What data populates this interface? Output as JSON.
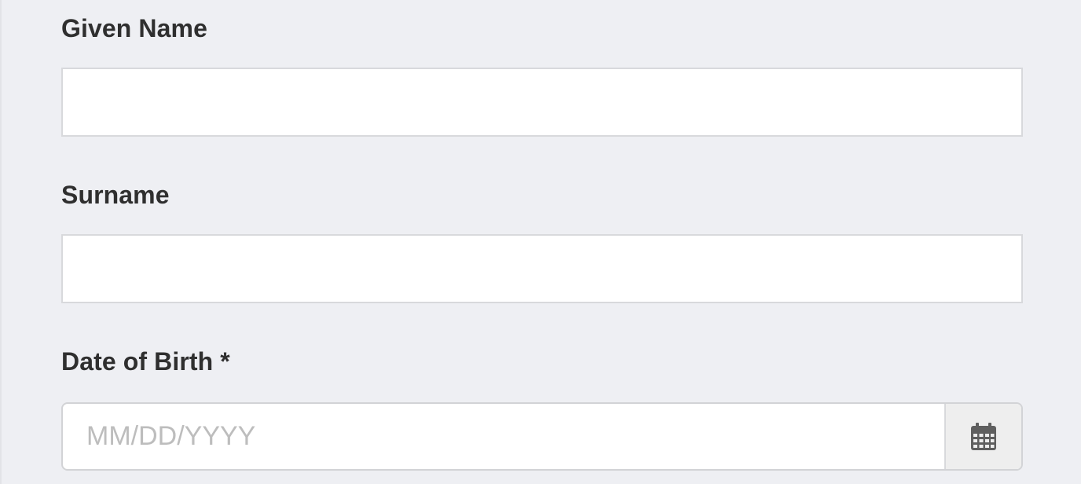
{
  "form": {
    "given_name": {
      "label": "Given Name",
      "value": "",
      "placeholder": ""
    },
    "surname": {
      "label": "Surname",
      "value": "",
      "placeholder": ""
    },
    "date_of_birth": {
      "label": "Date of Birth *",
      "value": "",
      "placeholder": "MM/DD/YYYY",
      "icon": "calendar-icon"
    }
  }
}
